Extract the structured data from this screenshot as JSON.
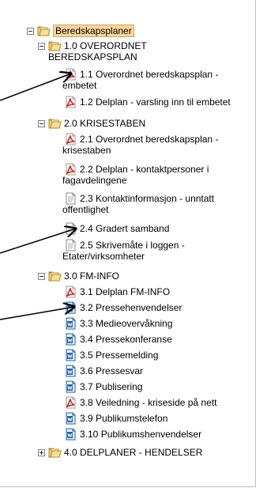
{
  "tree": {
    "root": {
      "label": "Beredskapsplaner",
      "expanded": true
    },
    "groups": [
      {
        "label_line1": "1.0 OVERORDNET",
        "label_line2": "BEREDSKAPSPLAN",
        "expanded": true,
        "items": [
          {
            "icon": "pdf-icon",
            "line1": "1.1 Overordnet beredskapsplan -",
            "line2": "embetet"
          },
          {
            "icon": "pdf-icon",
            "line1": "1.2 Delplan - varsling inn til embetet"
          }
        ]
      },
      {
        "label": "2.0 KRISESTABEN",
        "expanded": true,
        "items": [
          {
            "icon": "pdf-icon",
            "line1": "2.1 Overordnet beredskapsplan -",
            "line2": "krisestaben"
          },
          {
            "icon": "pdf-icon",
            "line1": "2.2 Delplan - kontaktpersoner i",
            "line2": "fagavdelingene"
          },
          {
            "icon": "document-icon",
            "line1": "2.3 Kontaktinformasjon - unntatt",
            "line2": "offentlighet"
          },
          {
            "icon": "document-icon",
            "line1": "2.4 Gradert samband"
          },
          {
            "icon": "document-icon",
            "line1": "2.5 Skrivemåte i loggen -",
            "line2": "Etater/virksomheter"
          }
        ]
      },
      {
        "label": "3.0 FM-INFO",
        "expanded": true,
        "items": [
          {
            "icon": "pdf-icon",
            "line1": "3.1 Delplan FM-INFO"
          },
          {
            "icon": "word-document-icon",
            "line1": "3.2 Pressehenvendelser"
          },
          {
            "icon": "word-document-icon",
            "line1": "3.3 Medieovervåkning"
          },
          {
            "icon": "word-document-icon",
            "line1": "3.4 Pressekonferanse"
          },
          {
            "icon": "word-document-icon",
            "line1": "3.5 Pressemelding"
          },
          {
            "icon": "word-document-icon",
            "line1": "3.6 Pressesvar"
          },
          {
            "icon": "word-document-icon",
            "line1": "3.7 Publisering"
          },
          {
            "icon": "pdf-icon",
            "line1": "3.8 Veiledning - kriseside på nett"
          },
          {
            "icon": "word-document-icon",
            "line1": "3.9 Publikumstelefon"
          },
          {
            "icon": "word-document-icon",
            "line1": "3.10 Publikumshenvendelser"
          }
        ]
      },
      {
        "label": "4.0 DELPLANER - HENDELSER",
        "expanded": false,
        "items": []
      }
    ]
  },
  "colors": {
    "folder_fill": "#f2cf63",
    "folder_edge": "#b08a2a",
    "root_highlight": "#f9d69a",
    "pdf_red": "#d8231b",
    "word_blue": "#1f5fa8"
  }
}
